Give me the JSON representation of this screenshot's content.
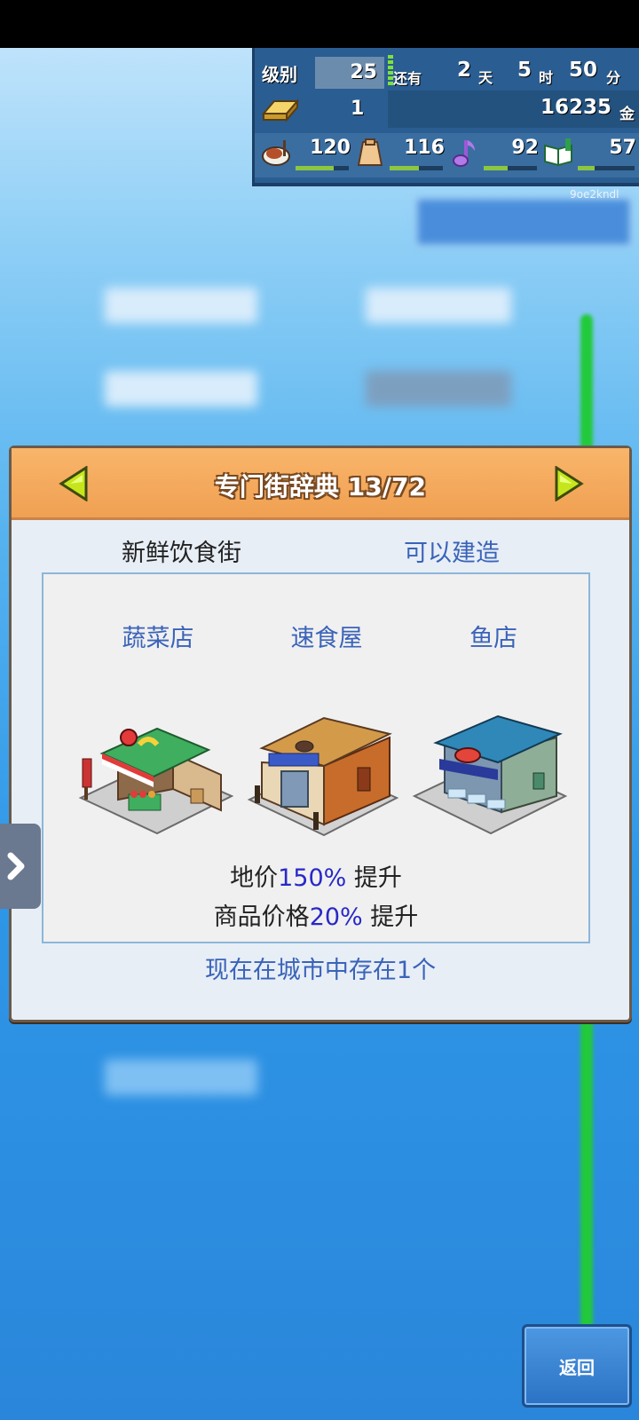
{
  "hud": {
    "level_label": "级别",
    "level_value": "25",
    "remaining_label": "还有",
    "days": "2",
    "days_unit": "天",
    "hours": "5",
    "hours_unit": "时",
    "minutes": "50",
    "minutes_unit": "分",
    "gold_bars": "1",
    "money": "16235",
    "money_unit": "金",
    "stats": [
      {
        "icon": "food-icon",
        "value": "120",
        "level": 0.72
      },
      {
        "icon": "bag-icon",
        "value": "116",
        "level": 0.55
      },
      {
        "icon": "music-note-icon",
        "value": "92",
        "level": 0.45
      },
      {
        "icon": "book-icon",
        "value": "57",
        "level": 0.3
      }
    ],
    "code": "9oe2kndl"
  },
  "dialog": {
    "title": "专门街辞典 13/72",
    "street_name": "新鲜饮食街",
    "status": "可以建造",
    "shops": [
      {
        "name": "蔬菜店",
        "icon": "vegetable-shop-icon"
      },
      {
        "name": "速食屋",
        "icon": "fast-food-shop-icon"
      },
      {
        "name": "鱼店",
        "icon": "fish-shop-icon"
      }
    ],
    "effect1_prefix": "地价",
    "effect1_value": "150%",
    "effect1_suffix": " 提升",
    "effect2_prefix": "商品价格",
    "effect2_value": "20%",
    "effect2_suffix": " 提升",
    "exists_text": "现在在城市中存在1个"
  },
  "back_button": "返回",
  "colors": {
    "header_orange": "#f0a052",
    "link_blue": "#3a63b9",
    "highlight_blue": "#2828c8",
    "hud_blue": "#2a5d92"
  }
}
